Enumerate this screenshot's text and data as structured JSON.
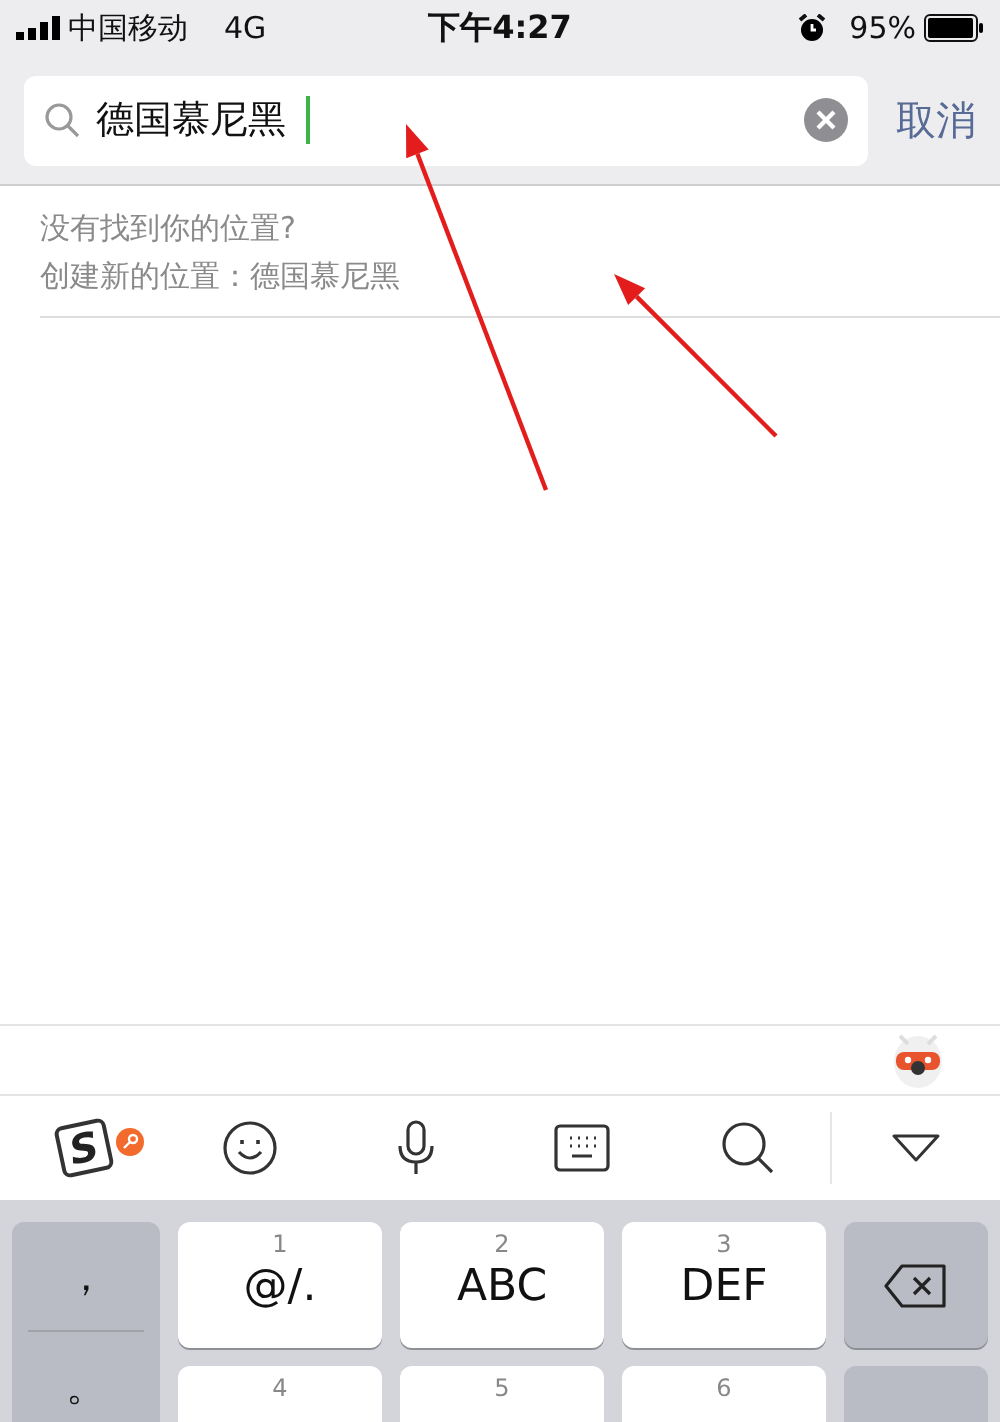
{
  "status_bar": {
    "carrier": "中国移动",
    "network": "4G",
    "time": "下午4:27",
    "battery": "95%"
  },
  "search": {
    "value": "德国慕尼黑",
    "cancel": "取消"
  },
  "results": {
    "not_found": "没有找到你的位置?",
    "create": "创建新的位置：德国慕尼黑"
  },
  "keyboard": {
    "logo": "S",
    "punctuation": [
      "，",
      "。"
    ],
    "keys": [
      {
        "digit": "1",
        "label": "@/."
      },
      {
        "digit": "2",
        "label": "ABC"
      },
      {
        "digit": "3",
        "label": "DEF"
      },
      {
        "digit": "4"
      },
      {
        "digit": "5"
      },
      {
        "digit": "6"
      }
    ]
  },
  "annotations": [
    {
      "kind": "arrow"
    },
    {
      "kind": "arrow"
    }
  ]
}
